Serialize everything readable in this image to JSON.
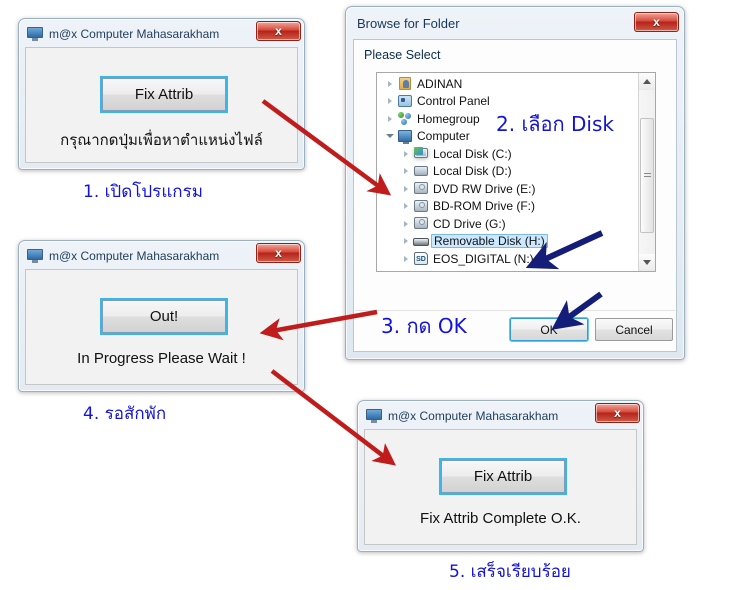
{
  "app_window_title": "m@x Computer Mahasarakham",
  "close_glyph": "x",
  "windows": {
    "step1": {
      "title": "m@x Computer Mahasarakham",
      "button_label": "Fix Attrib",
      "message": "กรุณากดปุ่มเพื่อหาตำแหน่งไฟล์",
      "caption": "1. เปิดโปรแกรม"
    },
    "step4": {
      "title": "m@x Computer Mahasarakham",
      "button_label": "Out!",
      "message": "In Progress Please Wait !",
      "caption": "4. รอสักพัก"
    },
    "step5": {
      "title": "m@x Computer Mahasarakham",
      "button_label": "Fix Attrib",
      "message": "Fix Attrib Complete O.K.",
      "caption": "5. เสร็จเรียบร้อย"
    }
  },
  "dialog": {
    "title": "Browse for Folder",
    "prompt": "Please Select",
    "caption_select_disk": "2. เลือก Disk",
    "caption_press_ok": "3. กด OK",
    "ok_label": "OK",
    "cancel_label": "Cancel",
    "tree": [
      {
        "label": "ADINAN",
        "icon": "user-folder-icon",
        "indent": 0,
        "expander": "collapsed",
        "selected": false
      },
      {
        "label": "Control Panel",
        "icon": "control-panel-icon",
        "indent": 0,
        "expander": "collapsed",
        "selected": false
      },
      {
        "label": "Homegroup",
        "icon": "homegroup-icon",
        "indent": 0,
        "expander": "collapsed",
        "selected": false
      },
      {
        "label": "Computer",
        "icon": "computer-icon",
        "indent": 0,
        "expander": "expanded",
        "selected": false
      },
      {
        "label": "Local Disk (C:)",
        "icon": "system-drive-icon",
        "indent": 1,
        "expander": "collapsed",
        "selected": false
      },
      {
        "label": "Local Disk (D:)",
        "icon": "hard-drive-icon",
        "indent": 1,
        "expander": "collapsed",
        "selected": false
      },
      {
        "label": "DVD RW Drive (E:)",
        "icon": "optical-drive-icon",
        "indent": 1,
        "expander": "collapsed",
        "selected": false
      },
      {
        "label": "BD-ROM Drive (F:)",
        "icon": "optical-drive-icon",
        "indent": 1,
        "expander": "collapsed",
        "selected": false
      },
      {
        "label": "CD Drive (G:)",
        "icon": "optical-drive-icon",
        "indent": 1,
        "expander": "collapsed",
        "selected": false
      },
      {
        "label": "Removable Disk (H:)",
        "icon": "removable-disk-icon",
        "indent": 1,
        "expander": "collapsed",
        "selected": true
      },
      {
        "label": "EOS_DIGITAL (N:)",
        "icon": "sd-card-icon",
        "indent": 1,
        "expander": "collapsed",
        "selected": false
      }
    ]
  },
  "colors": {
    "caption_blue": "#1414d8",
    "arrow_red": "#c01c1c",
    "arrow_navy": "#141e78",
    "selection_blue": "#cce8ff"
  }
}
